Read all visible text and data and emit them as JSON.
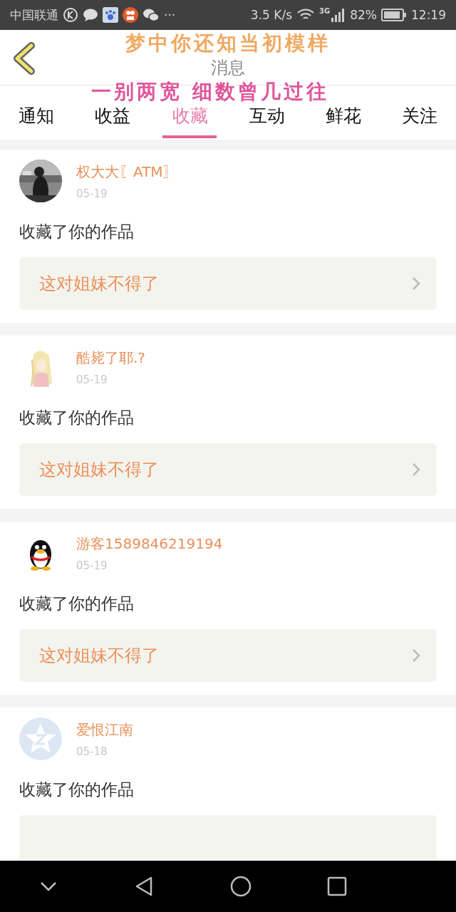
{
  "status_bar": {
    "carrier": "中国联通",
    "more": "···",
    "speed": "3.5 K/s",
    "network": "3G",
    "battery": "82%",
    "time": "12:19"
  },
  "header": {
    "title": "消息"
  },
  "lyrics": [
    "梦中你还知当初模样",
    "一别两宽 细数曾几过往"
  ],
  "tabs": [
    {
      "label": "通知",
      "selected": false
    },
    {
      "label": "收益",
      "selected": false
    },
    {
      "label": "收藏",
      "selected": true
    },
    {
      "label": "互动",
      "selected": false
    },
    {
      "label": "鲜花",
      "selected": false
    },
    {
      "label": "关注",
      "selected": false
    }
  ],
  "messages": [
    {
      "name": "权大大〖ATM〗",
      "date": "05-19",
      "text": "收藏了你的作品",
      "work": "这对姐妹不得了"
    },
    {
      "name": "酷毙了耶.?",
      "date": "05-19",
      "text": "收藏了你的作品",
      "work": "这对姐妹不得了"
    },
    {
      "avatar": {
        "kind": "penguin"
      },
      "name": "游客1589846219194",
      "date": "05-19",
      "text": "收藏了你的作品",
      "work": "这对姐妹不得了"
    },
    {
      "avatar": {
        "kind": "star"
      },
      "name": "爱恨江南",
      "date": "05-18",
      "text": "收藏了你的作品"
    }
  ]
}
